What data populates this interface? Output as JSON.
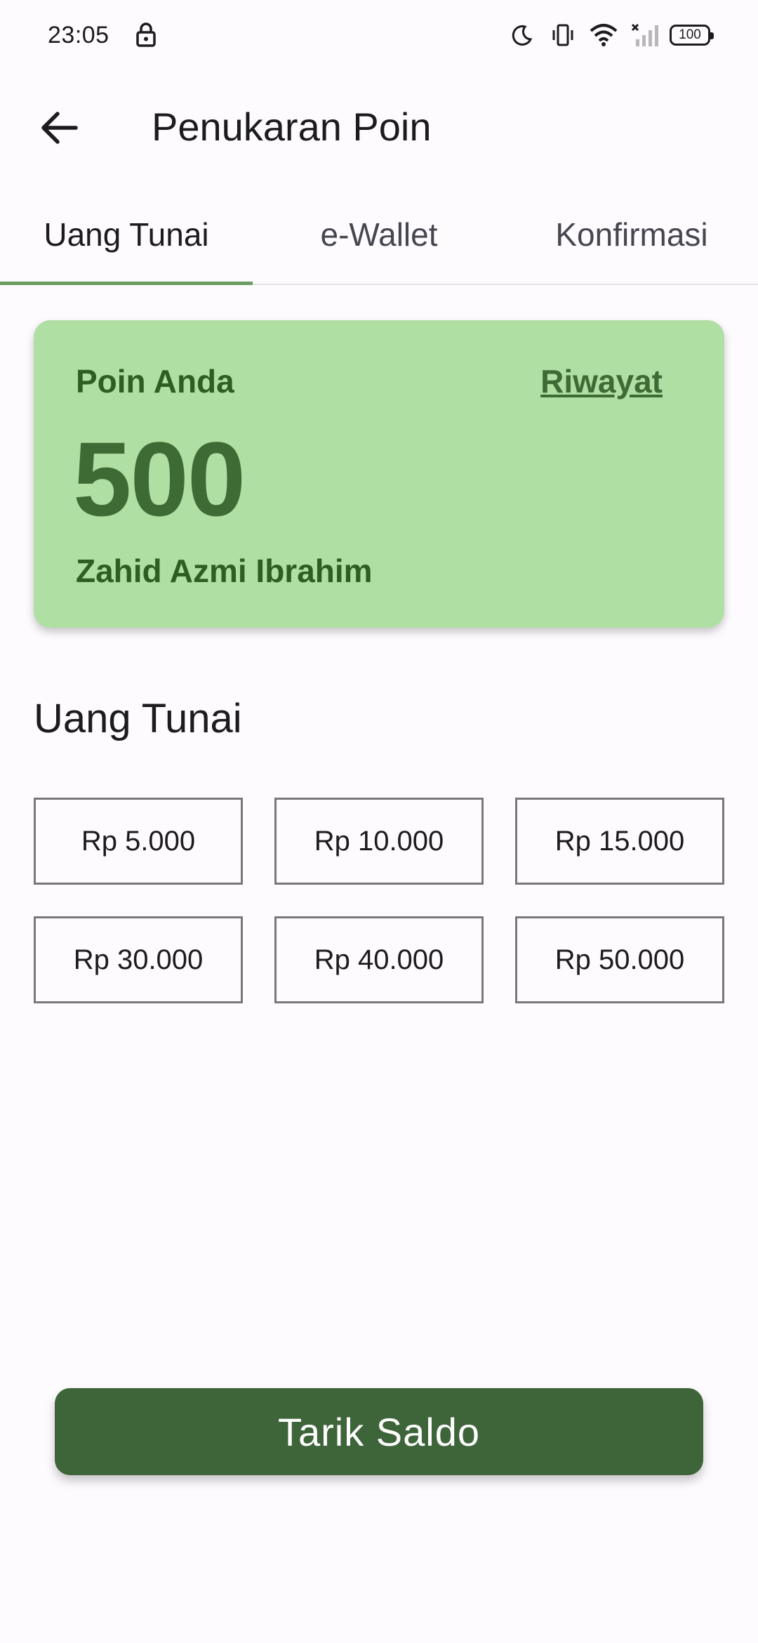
{
  "status_bar": {
    "time": "23:05",
    "battery": "100",
    "icons": [
      "lock-icon",
      "moon-icon",
      "vibrate-icon",
      "wifi-icon",
      "signal-icon",
      "battery-icon"
    ]
  },
  "app_bar": {
    "title": "Penukaran Poin",
    "back_icon": "arrow-back-icon"
  },
  "tabs": [
    {
      "label": "Uang Tunai",
      "active": true
    },
    {
      "label": "e-Wallet",
      "active": false
    },
    {
      "label": "Konfirmasi",
      "active": false
    }
  ],
  "points_card": {
    "label": "Poin Anda",
    "history_link": "Riwayat",
    "points": "500",
    "user_name": "Zahid Azmi Ibrahim"
  },
  "section": {
    "title": "Uang Tunai"
  },
  "amounts": [
    "Rp 5.000",
    "Rp 10.000",
    "Rp 15.000",
    "Rp 30.000",
    "Rp 40.000",
    "Rp 50.000"
  ],
  "withdraw_button": "Tarik Saldo",
  "colors": {
    "card_background": "#b0dfa4",
    "card_text": "#2f5e22",
    "points_text": "#3e6b34",
    "button_background": "#3e6439",
    "tab_indicator": "#6a9c5f",
    "page_background": "#fefbfe"
  }
}
